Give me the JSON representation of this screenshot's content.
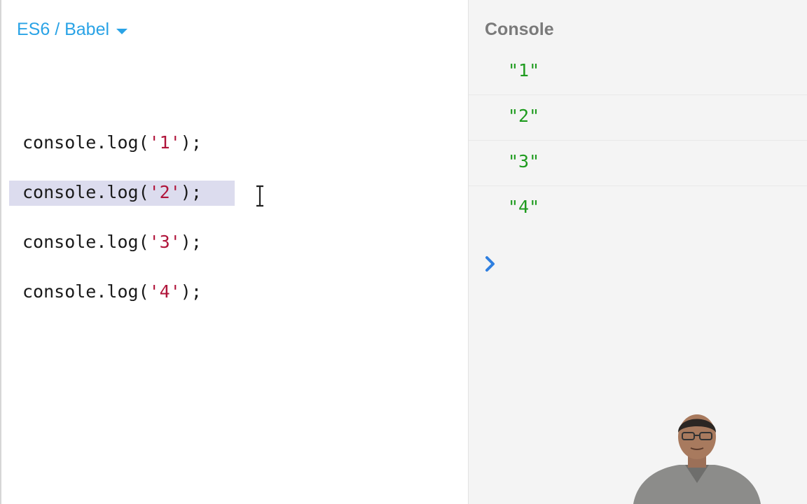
{
  "editor": {
    "language_selector": {
      "label": "ES6 / Babel",
      "icon": "caret-down-icon"
    },
    "lines": [
      {
        "prefix": "console.log(",
        "string": "'1'",
        "suffix": ");"
      },
      {
        "prefix": "console.log(",
        "string": "'2'",
        "suffix": ");"
      },
      {
        "prefix": "console.log(",
        "string": "'3'",
        "suffix": ");"
      },
      {
        "prefix": "console.log(",
        "string": "'4'",
        "suffix": ");"
      }
    ],
    "selected_line": 2
  },
  "console": {
    "title": "Console",
    "outputs": [
      "\"1\"",
      "\"2\"",
      "\"3\"",
      "\"4\""
    ],
    "prompt_icon": "chevron-right-icon"
  },
  "colors": {
    "accent": "#2aa3e6",
    "string": "#b0143a",
    "console_output": "#1e9b1e",
    "selection": "#dcdcee",
    "console_background": "#f4f4f4",
    "prompt": "#2f7fe0"
  }
}
